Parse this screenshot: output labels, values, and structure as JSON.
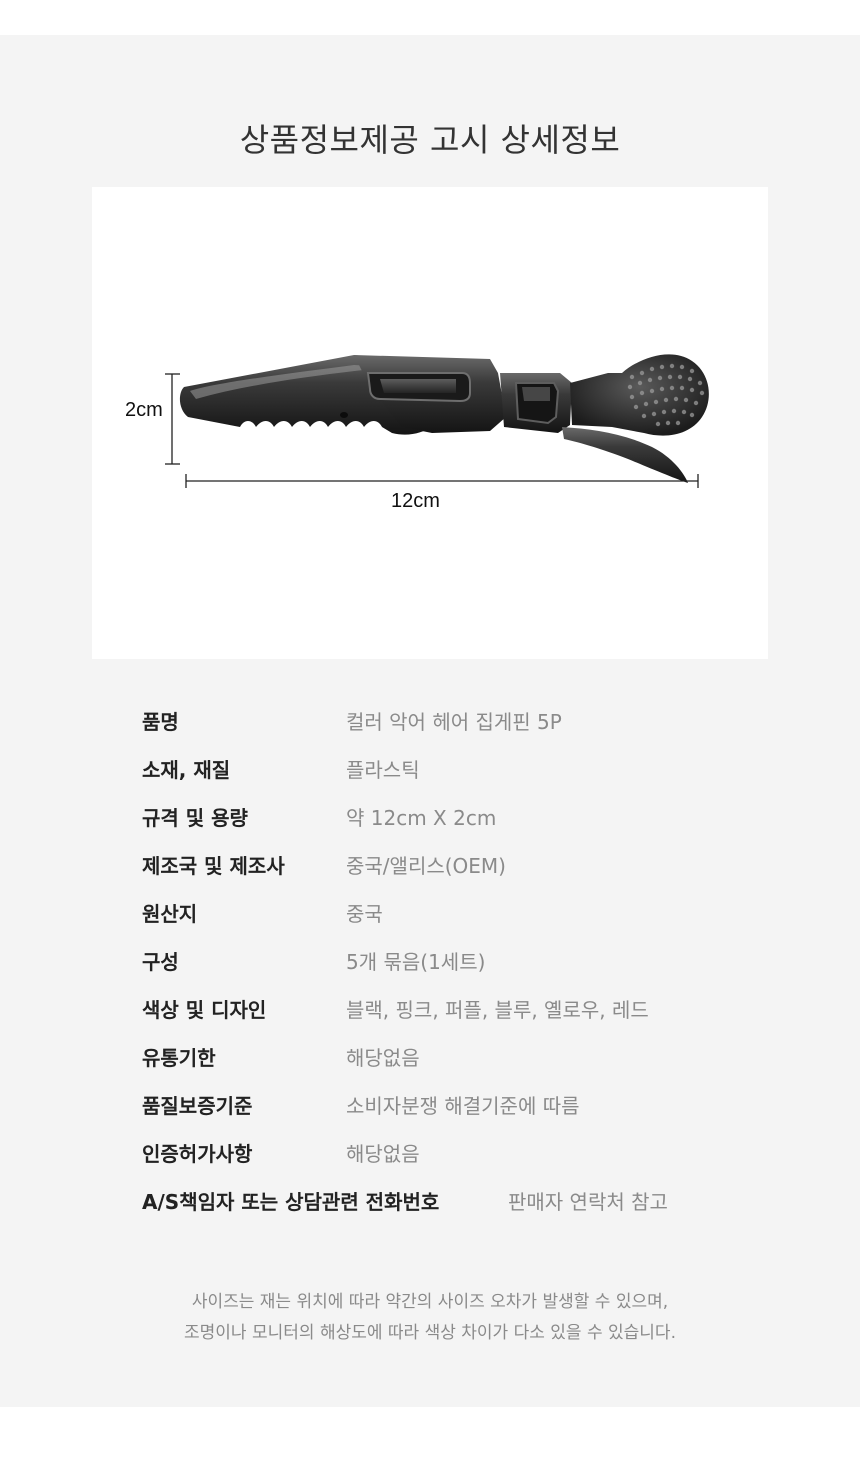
{
  "title": "상품정보제공 고시 상세정보",
  "figure": {
    "height_label": "2cm",
    "width_label": "12cm"
  },
  "specs": [
    {
      "key": "품명",
      "value": "컬러 악어 헤어 집게핀 5P"
    },
    {
      "key": "소재, 재질",
      "value": "플라스틱"
    },
    {
      "key": "규격 및 용량",
      "value": "약 12cm X 2cm"
    },
    {
      "key": "제조국 및 제조사",
      "value": "중국/앨리스(OEM)"
    },
    {
      "key": "원산지",
      "value": "중국"
    },
    {
      "key": "구성",
      "value": "5개 묶음(1세트)"
    },
    {
      "key": "색상 및 디자인",
      "value": "블랙, 핑크, 퍼플, 블루, 옐로우, 레드"
    },
    {
      "key": "유통기한",
      "value": "해당없음"
    },
    {
      "key": "품질보증기준",
      "value": "소비자분쟁 해결기준에 따름"
    },
    {
      "key": "인증허가사항",
      "value": "해당없음"
    },
    {
      "key": "A/S책임자 또는 상담관련 전화번호",
      "value": "판매자 연락처 참고"
    }
  ],
  "note": {
    "line1": "사이즈는 재는 위치에 따라 약간의 사이즈 오차가 발생할 수 있으며,",
    "line2": "조명이나 모니터의 해상도에 따라 색상 차이가 다소 있을 수 있습니다."
  },
  "colors": {
    "panel_bg": "#f4f4f4",
    "clip_body": "#2b2b2b",
    "text_key": "#222222",
    "text_value": "#8a8a8a"
  }
}
